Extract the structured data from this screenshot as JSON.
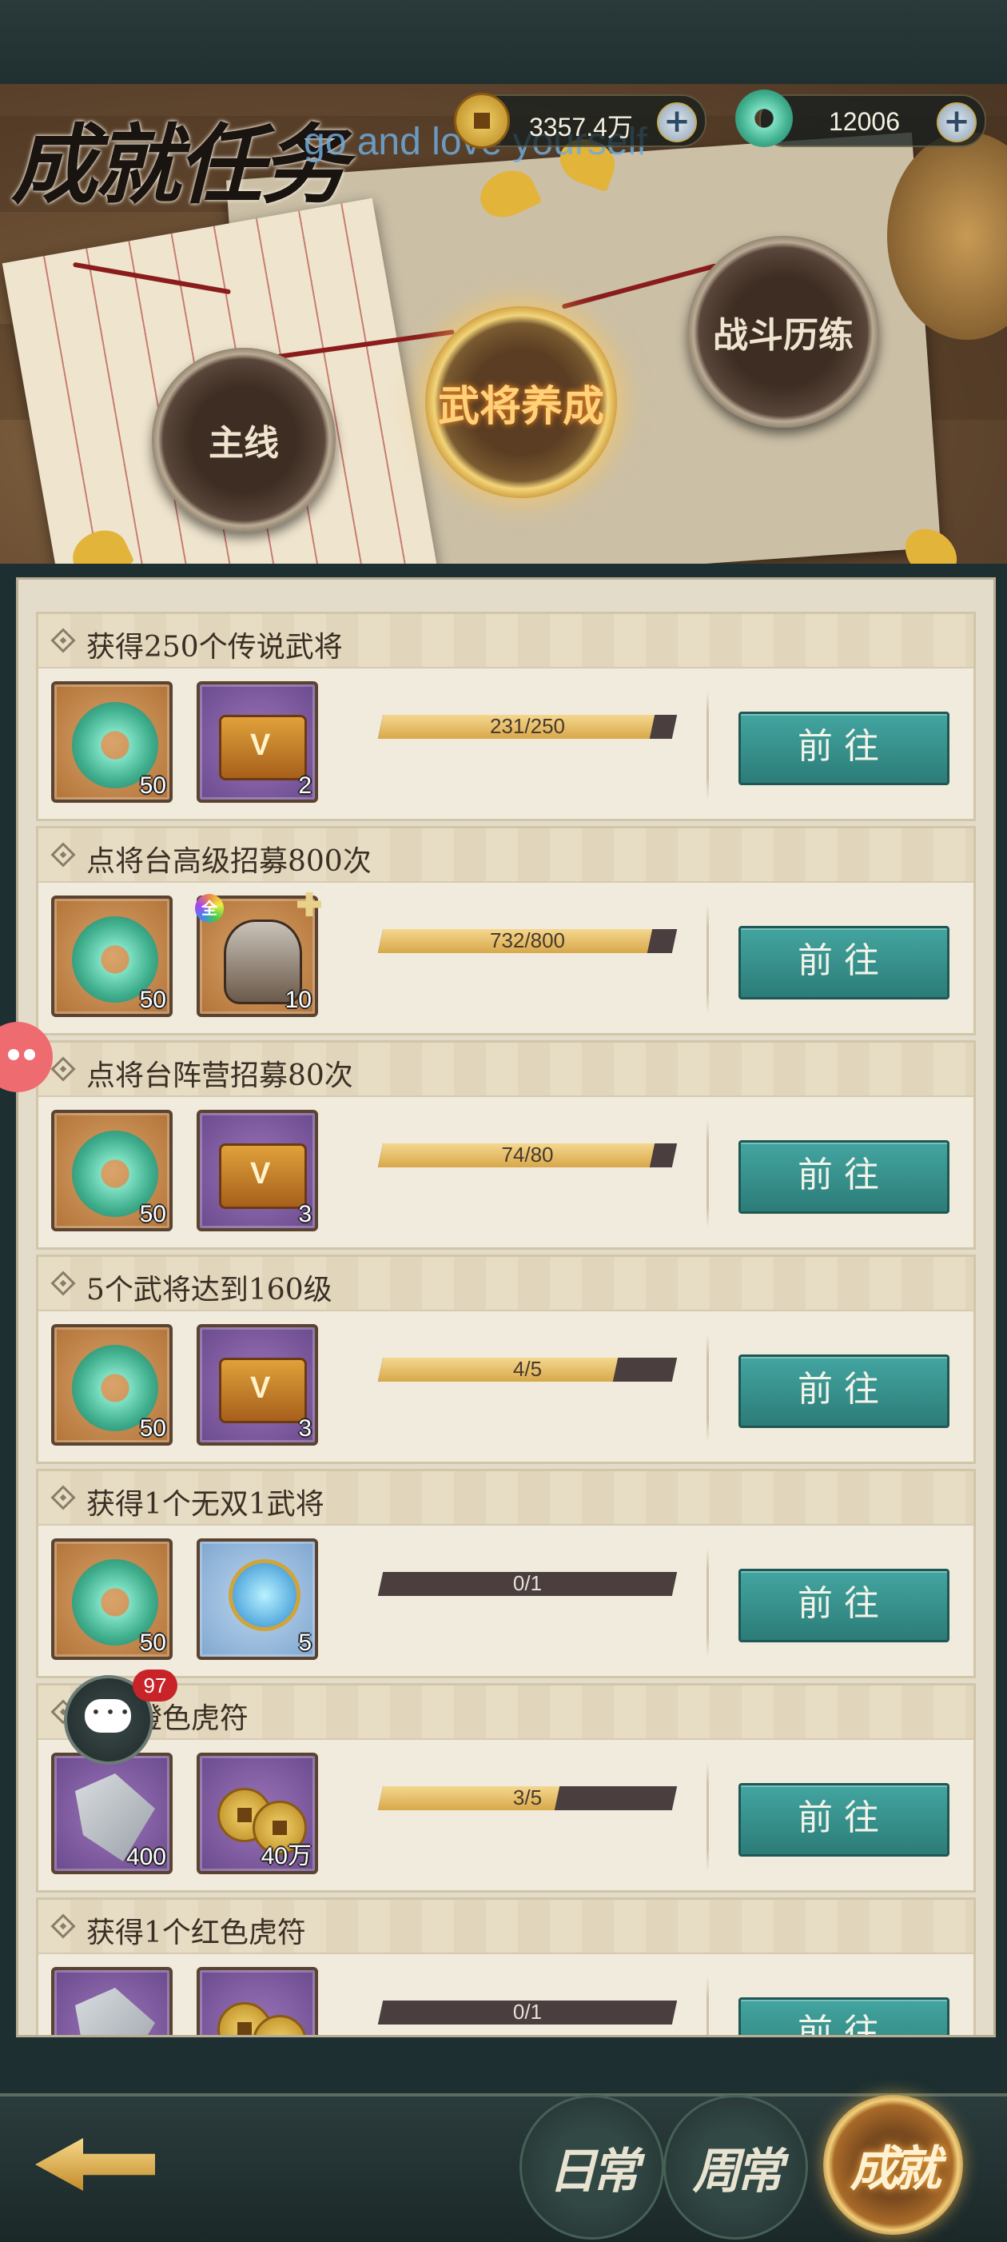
{
  "header": {
    "title": "成就任务",
    "watermark": "go and love yourself",
    "coin_amount": "3357.4万",
    "jade_amount": "12006",
    "coin_icon": "coin-icon",
    "jade_icon": "jade-icon"
  },
  "categories": {
    "main": "主线",
    "hero_training": "武将养成",
    "battle": "战斗历练",
    "active": "hero_training"
  },
  "go_label": "前往",
  "tasks": [
    {
      "title": "获得250个传说武将",
      "progress_text": "231/250",
      "progress": 0.924,
      "rewards": [
        {
          "icon": "jade-icon",
          "count": "50"
        },
        {
          "icon": "treasure-chest-icon",
          "count": "2"
        }
      ]
    },
    {
      "title": "点将台高级招募800次",
      "progress_text": "732/800",
      "progress": 0.915,
      "rewards": [
        {
          "icon": "jade-icon",
          "count": "50"
        },
        {
          "icon": "hero-fragment-icon",
          "count": "10",
          "badge": "全"
        }
      ]
    },
    {
      "title": "点将台阵营招募80次",
      "progress_text": "74/80",
      "progress": 0.925,
      "rewards": [
        {
          "icon": "jade-icon",
          "count": "50"
        },
        {
          "icon": "treasure-chest-icon",
          "count": "3"
        }
      ]
    },
    {
      "title": "5个武将达到160级",
      "progress_text": "4/5",
      "progress": 0.8,
      "rewards": [
        {
          "icon": "jade-icon",
          "count": "50"
        },
        {
          "icon": "treasure-chest-icon",
          "count": "3"
        }
      ]
    },
    {
      "title": "获得1个无双1武将",
      "progress_text": "0/1",
      "progress": 0,
      "rewards": [
        {
          "icon": "jade-icon",
          "count": "50"
        },
        {
          "icon": "crystal-orb-icon",
          "count": "5"
        }
      ]
    },
    {
      "title": "5个橙色虎符",
      "progress_text": "3/5",
      "progress": 0.6,
      "rewards": [
        {
          "icon": "tiger-tally-icon",
          "count": "400"
        },
        {
          "icon": "coins-icon",
          "count": "40万"
        }
      ]
    },
    {
      "title": "获得1个红色虎符",
      "progress_text": "0/1",
      "progress": 0,
      "rewards": [
        {
          "icon": "tiger-tally-icon",
          "count": ""
        },
        {
          "icon": "coins-icon",
          "count": ""
        }
      ]
    }
  ],
  "chat": {
    "unread": "97",
    "icon": "chat-icon"
  },
  "bottom_tabs": {
    "daily": "日常",
    "weekly": "周常",
    "achievement": "成就",
    "active": "achievement"
  },
  "back_icon": "back-arrow-icon"
}
